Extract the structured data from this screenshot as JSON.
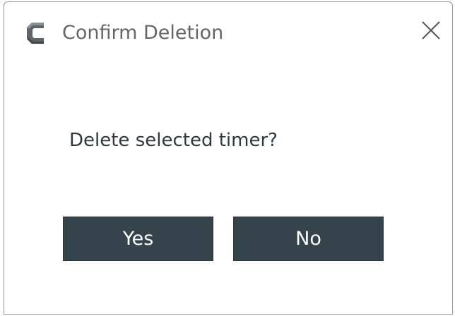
{
  "dialog": {
    "title": "Confirm Deletion",
    "app_icon": "app-logo-icon",
    "close_icon": "close-icon",
    "message": "Delete selected timer?",
    "yes_label": "Yes",
    "no_label": "No"
  },
  "colors": {
    "button_bg": "#35434a",
    "button_text": "#ffffff",
    "title_text": "#666666",
    "message_text": "#2f3a40",
    "window_border": "#9a9a9a"
  }
}
